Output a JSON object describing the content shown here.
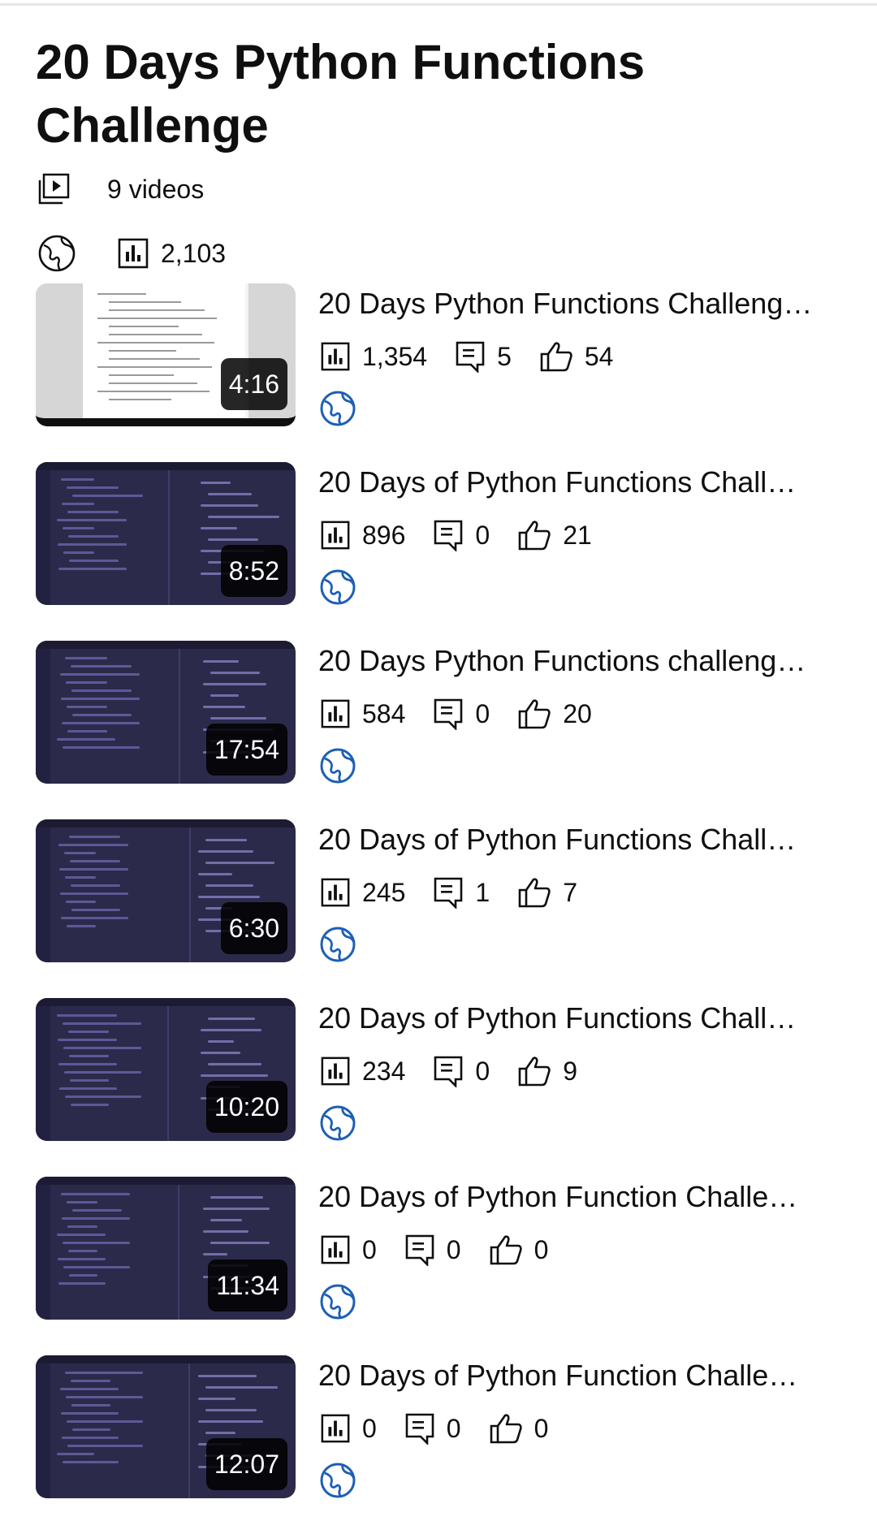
{
  "playlist": {
    "title": "20 Days Python Functions Challenge",
    "video_count": "9 videos",
    "total_views": "2,103",
    "visibility_icon": "globe-icon"
  },
  "icons": {
    "playlist": "playlist-play-icon",
    "views": "bar-chart-icon",
    "comments": "comment-icon",
    "likes": "thumbs-up-icon",
    "visibility": "globe-icon"
  },
  "colors": {
    "text": "#0f0f0f",
    "globe_blue": "#1d5fb5",
    "thumb_editor": "#2c2a4a"
  },
  "videos": [
    {
      "title": "20 Days Python Functions Challeng…",
      "duration": "4:16",
      "views": "1,354",
      "comments": "5",
      "likes": "54"
    },
    {
      "title": "20 Days of Python Functions Chall…",
      "duration": "8:52",
      "views": "896",
      "comments": "0",
      "likes": "21"
    },
    {
      "title": "20 Days Python Functions challeng…",
      "duration": "17:54",
      "views": "584",
      "comments": "0",
      "likes": "20"
    },
    {
      "title": "20 Days of Python Functions Chall…",
      "duration": "6:30",
      "views": "245",
      "comments": "1",
      "likes": "7"
    },
    {
      "title": "20 Days of Python Functions Chall…",
      "duration": "10:20",
      "views": "234",
      "comments": "0",
      "likes": "9"
    },
    {
      "title": "20 Days of Python Function Challe…",
      "duration": "11:34",
      "views": "0",
      "comments": "0",
      "likes": "0"
    },
    {
      "title": "20 Days of Python Function Challe…",
      "duration": "12:07",
      "views": "0",
      "comments": "0",
      "likes": "0"
    }
  ]
}
